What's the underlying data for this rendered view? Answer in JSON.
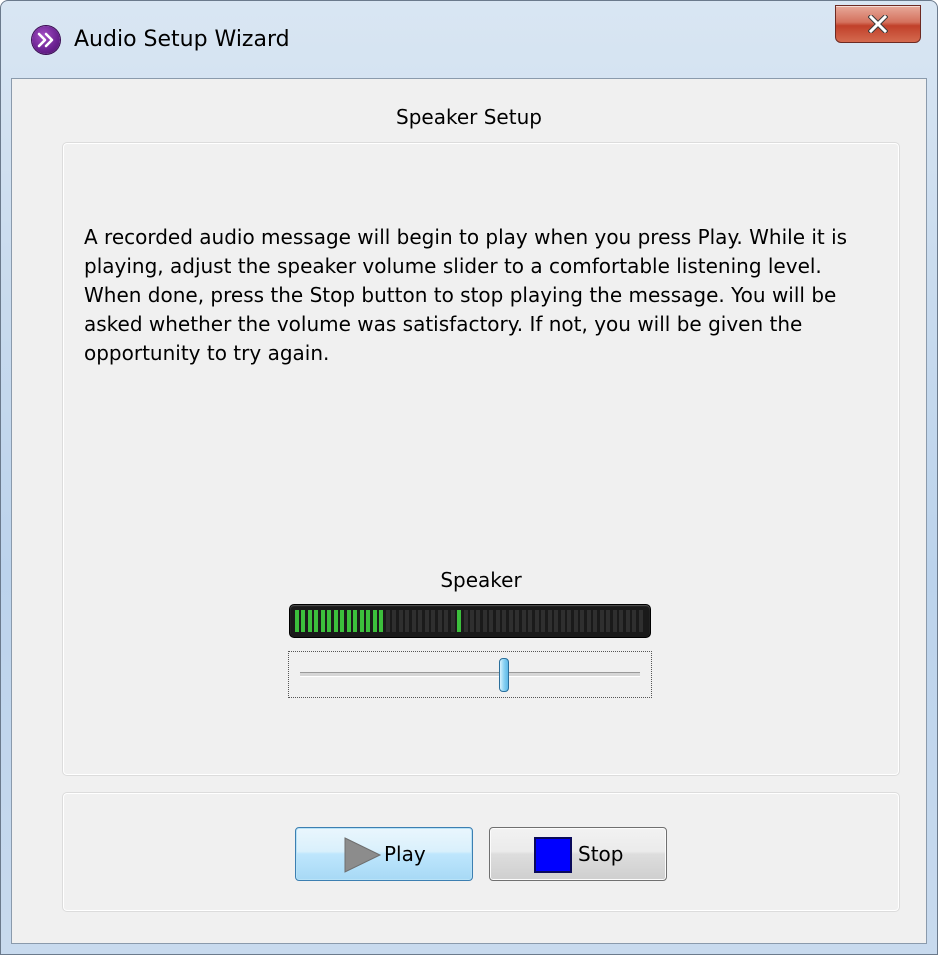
{
  "window": {
    "title": "Audio Setup Wizard",
    "app_icon": "wizard-chevron-icon",
    "close_icon": "close-icon"
  },
  "section_title": "Speaker Setup",
  "message": "A recorded audio message will begin to play when you press Play. While it is playing, adjust the speaker volume slider to a comfortable listening level. When done, press the Stop button to stop playing the message. You will be asked whether the volume was satisfactory. If not, you will be given the opportunity to try again.",
  "speaker": {
    "label": "Speaker",
    "meter_level_fraction": 0.25,
    "meter_peak_fraction": 0.47,
    "volume_fraction": 0.6
  },
  "buttons": {
    "play_label": "Play",
    "stop_label": "Stop"
  },
  "colors": {
    "meter_on": "#3cbf3c",
    "stop_icon": "#0000ff",
    "close_button": "#c1402a"
  }
}
